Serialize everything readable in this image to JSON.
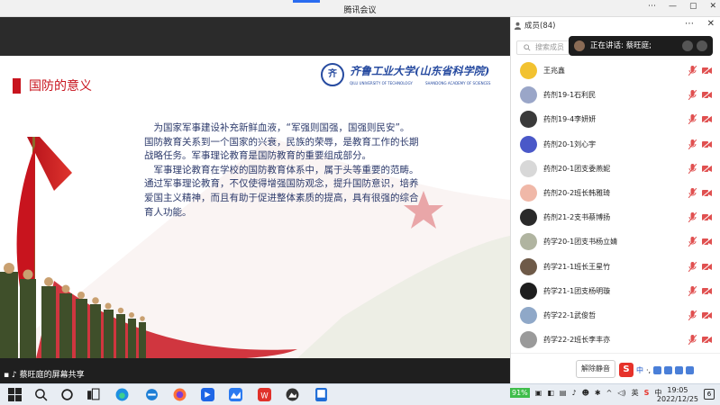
{
  "window": {
    "title": "腾讯会议",
    "controls": [
      "⋯",
      "—",
      "▢",
      "✕"
    ]
  },
  "slide": {
    "title": "国防的意义",
    "logo": {
      "seal": "齐",
      "name": "齐鲁工业大学(山东省科学院)",
      "sub_left": "QILU UNIVERSITY OF TECHNOLOGY",
      "sub_right": "SHANDONG ACADEMY OF SCIENCES"
    },
    "paragraphs": [
      "为国家军事建设补充新鲜血液，“军强则国强，国强则民安”。",
      "国防教育关系到一个国家的兴衰，民族的荣辱，是教育工作的长期战略任务。军事理论教育是国防教育的重要组成部分。",
      "军事理论教育在学校的国防教育体系中，属于头等重要的范畴。",
      "通过军事理论教育，不仅使得增强国防观念，提升国防意识，培养爱国主义精神，而且有助于促进整体素质的提高，具有很强的综合育人功能。"
    ]
  },
  "share_status": "蔡旺庭的屏幕共享",
  "panel": {
    "header": "成员(84)",
    "search_placeholder": "搜索成员",
    "speaking": "正在讲话: 蔡旺庭;",
    "members": [
      {
        "name": "王兆鑫",
        "color": "#f2c230"
      },
      {
        "name": "药剂19-1石利民",
        "color": "#9aa6c8"
      },
      {
        "name": "药剂19-4李妍妍",
        "color": "#3a3a3a"
      },
      {
        "name": "药剂20-1刘心宇",
        "color": "#4a58c8"
      },
      {
        "name": "药剂20-1团支委燕妮",
        "color": "#d8d8d8"
      },
      {
        "name": "药剂20-2班长韩雅琦",
        "color": "#f0b8a8"
      },
      {
        "name": "药剂21-2支书蔡博扬",
        "color": "#2a2a2a"
      },
      {
        "name": "药学20-1团支书杨立婧",
        "color": "#b0b4a0"
      },
      {
        "name": "药学21-1班长王星竹",
        "color": "#6e5a48"
      },
      {
        "name": "药学21-1团支杨明璇",
        "color": "#1e1e1e"
      },
      {
        "name": "药学22-1武俊哲",
        "color": "#8fa8c8"
      },
      {
        "name": "药学22-2班长李丰亦",
        "color": "#9a9a9a"
      }
    ],
    "mute_all": "解除静音",
    "ime": {
      "lang": "中",
      "punct": "·,"
    }
  },
  "taskbar": {
    "battery": "91%",
    "tray_lang": "英",
    "ime_indicator": "中",
    "time": "19:05",
    "date": "2022/12/25",
    "notification_count": "6"
  },
  "colors": {
    "accent_red": "#c8141e",
    "slide_text": "#2c3a6b",
    "logo_blue": "#274ba0"
  }
}
